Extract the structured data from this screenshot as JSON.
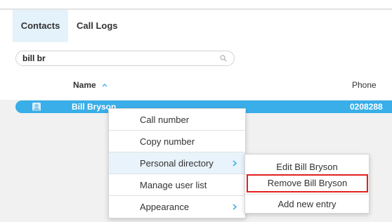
{
  "tabs": [
    {
      "label": "Contacts",
      "active": true
    },
    {
      "label": "Call Logs",
      "active": false
    }
  ],
  "search": {
    "value": "bill br",
    "icon": "search-icon"
  },
  "table": {
    "columns": {
      "name": "Name",
      "phone": "Phone"
    },
    "sort": {
      "column": "name",
      "direction": "ascending",
      "icon": "sort-up-icon"
    },
    "rows": [
      {
        "name": "Bill Bryson",
        "phone": "0208288",
        "selected": true
      }
    ]
  },
  "context_menu": {
    "items": [
      {
        "label": "Call number"
      },
      {
        "label": "Copy number"
      },
      {
        "label": "Personal directory",
        "has_submenu": true,
        "highlighted": true
      },
      {
        "label": "Manage user list"
      },
      {
        "label": "Appearance",
        "has_submenu": true
      }
    ]
  },
  "submenu": {
    "items": [
      {
        "label": "Edit Bill Bryson"
      },
      {
        "label": "Remove Bill Bryson",
        "outlined": true
      },
      {
        "label": "Add new entry"
      }
    ]
  },
  "colors": {
    "accent": "#39aee8",
    "tab_active_bg": "#e4f2fb",
    "outline_highlight": "#e02020"
  }
}
